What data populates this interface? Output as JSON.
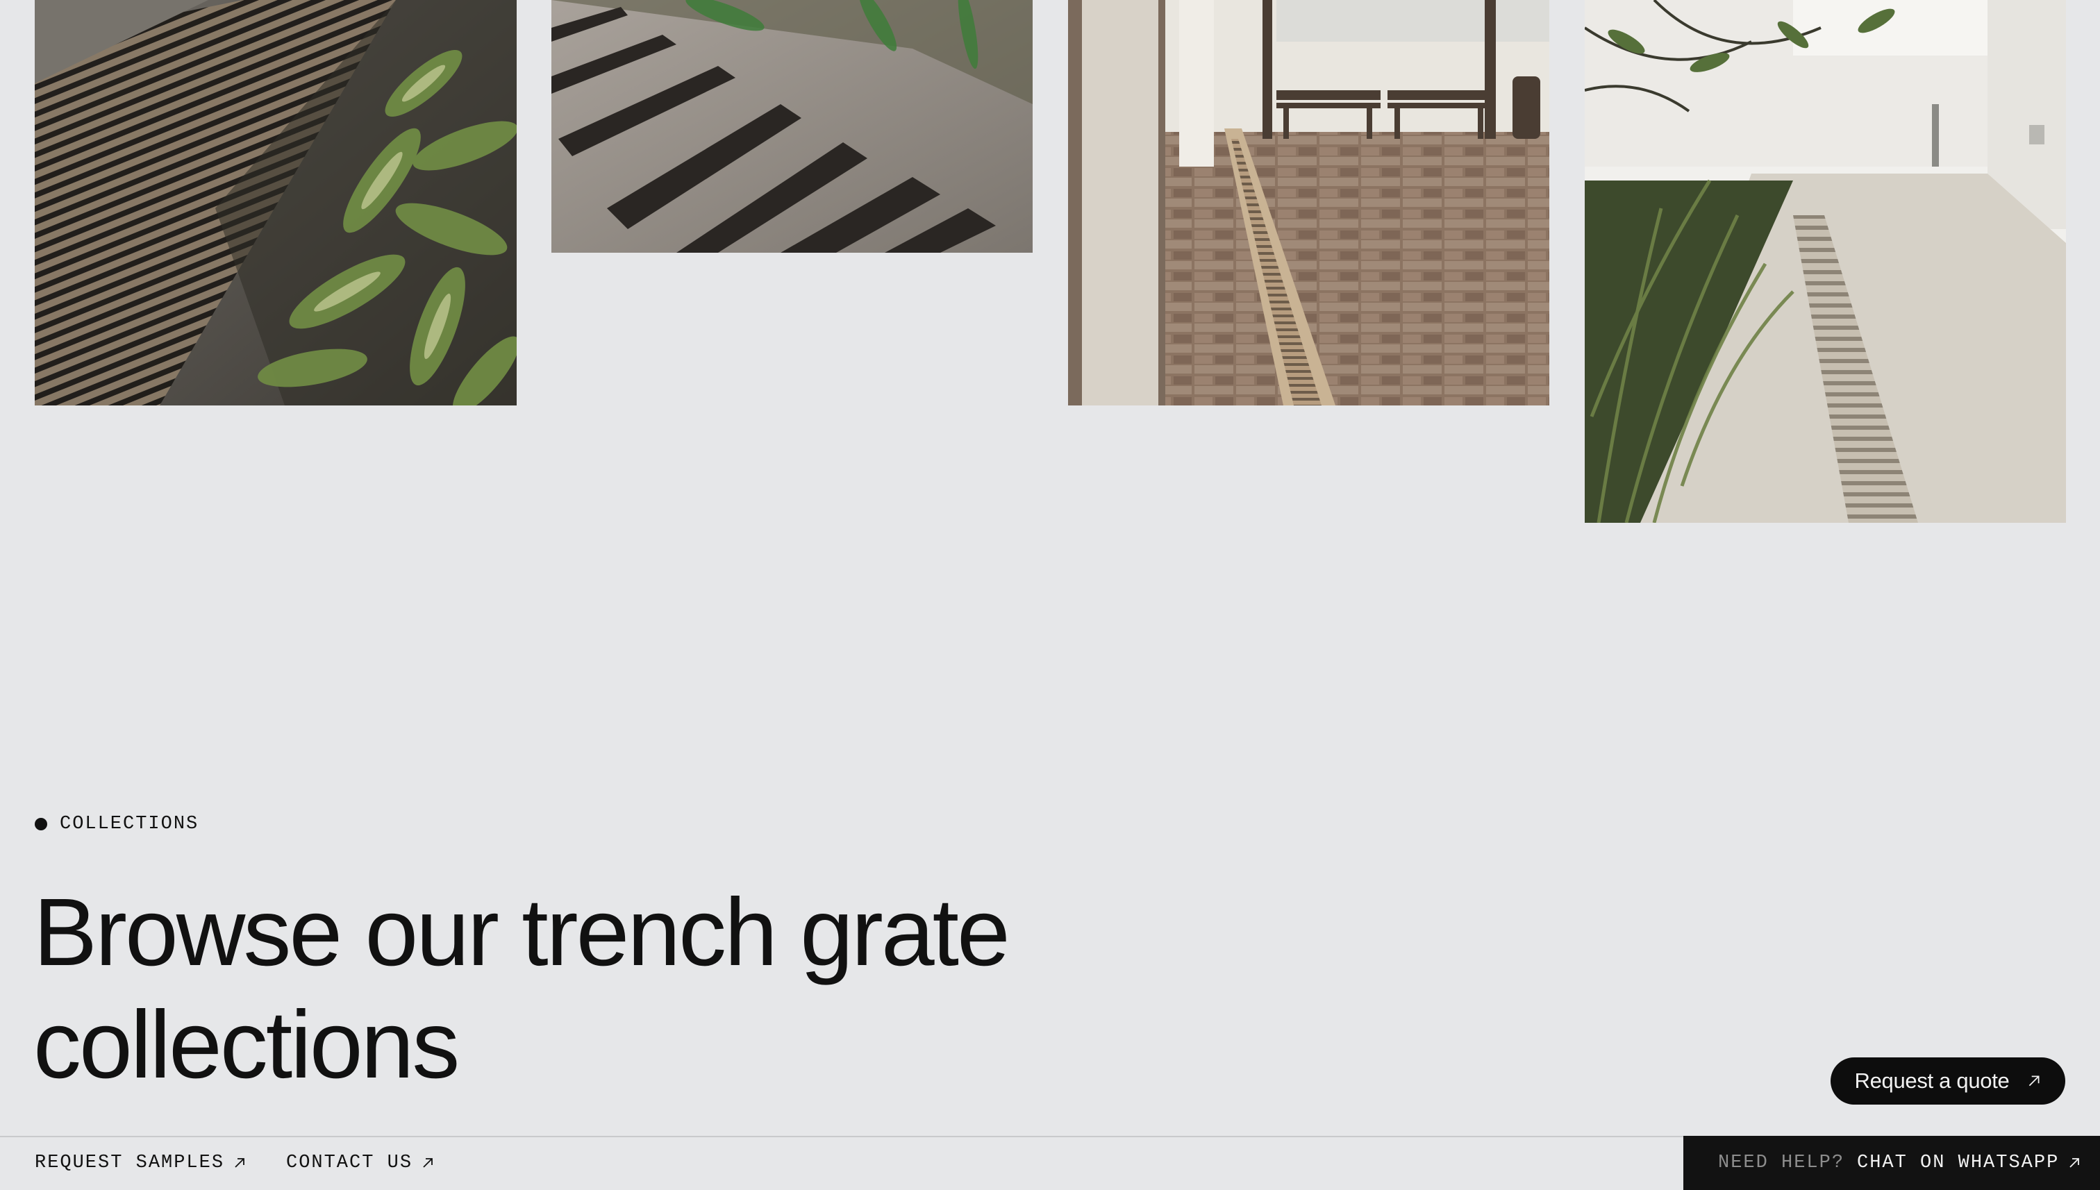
{
  "gallery": {
    "images": [
      {
        "name": "trench-grate-with-plants-photo"
      },
      {
        "name": "trench-grate-closeup-photo"
      },
      {
        "name": "courtyard-trench-drain-photo"
      },
      {
        "name": "walkway-trench-drain-photo"
      }
    ]
  },
  "section": {
    "eyebrow": "COLLECTIONS",
    "heading": "Browse our trench grate collections"
  },
  "quote_button": {
    "label": "Request a quote",
    "icon": "arrow-up-right-icon"
  },
  "bottom_bar": {
    "request_samples": "REQUEST SAMPLES",
    "contact_us": "CONTACT US",
    "help_prefix": "NEED HELP?",
    "whatsapp": "CHAT ON WHATSAPP"
  },
  "colors": {
    "background": "#e6e7e9",
    "text": "#111111",
    "button_bg": "#0d0d0d",
    "whatsapp_bg": "#121212",
    "muted": "#8d8d8d"
  }
}
